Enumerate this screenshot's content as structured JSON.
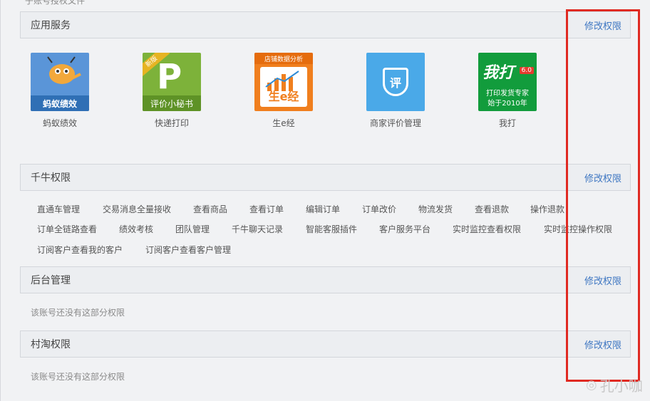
{
  "top_cut_text": "子账号授权文件",
  "sections": {
    "app_services": {
      "title": "应用服务",
      "edit": "修改权限"
    },
    "qianniu": {
      "title": "千牛权限",
      "edit": "修改权限"
    },
    "backend": {
      "title": "后台管理",
      "edit": "修改权限",
      "empty": "该账号还没有这部分权限"
    },
    "cuntao": {
      "title": "村淘权限",
      "edit": "修改权限",
      "empty": "该账号还没有这部分权限"
    }
  },
  "apps": [
    {
      "name": "蚂蚁绩效",
      "icon": "ant-performance-icon",
      "band": "蚂蚁绩效"
    },
    {
      "name": "快递打印",
      "icon": "express-print-icon",
      "band": "评价小秘书",
      "ribbon": "新版",
      "letter": "P"
    },
    {
      "name": "生e经",
      "icon": "shengejing-icon",
      "top": "店铺数据分析",
      "card": "生e经"
    },
    {
      "name": "商家评价管理",
      "icon": "rating-shield-icon",
      "glyph": "评"
    },
    {
      "name": "我打",
      "icon": "wo-da-icon",
      "big": "我打",
      "ver": "6.0",
      "l1": "打印发货专家",
      "l2": "始于2010年"
    }
  ],
  "qianniu_permissions": [
    [
      "直通车管理",
      "交易消息全量接收",
      "查看商品",
      "查看订单",
      "编辑订单",
      "订单改价",
      "物流发货",
      "查看退款",
      "操作退款"
    ],
    [
      "订单全链路查看",
      "绩效考核",
      "团队管理",
      "千牛聊天记录",
      "智能客服插件",
      "客户服务平台",
      "实时监控查看权限",
      "实时监控操作权限"
    ],
    [
      "订阅客户查看我的客户",
      "订阅客户查看客户管理"
    ]
  ],
  "watermark": {
    "text": "孔小咖",
    "icon": "weibo-icon"
  },
  "colors": {
    "link": "#3f77c2",
    "highlight": "#e02a22"
  }
}
